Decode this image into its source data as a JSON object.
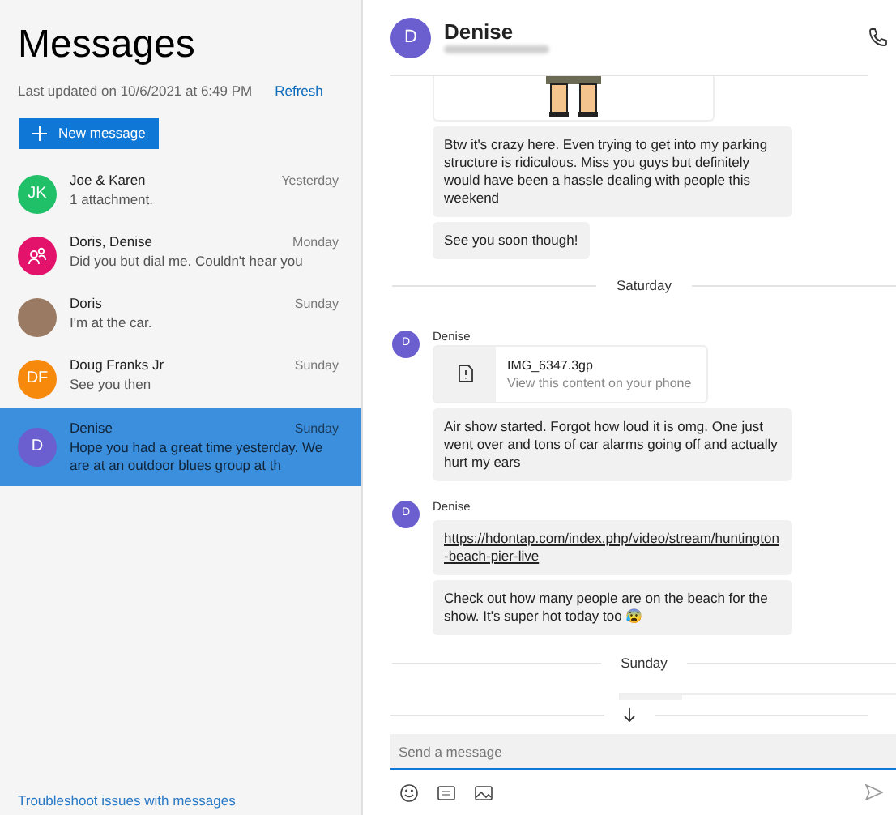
{
  "sidebar": {
    "title": "Messages",
    "last_updated": "Last updated on 10/6/2021 at 6:49 PM",
    "refresh": "Refresh",
    "new_message": "New message",
    "conversations": [
      {
        "avatar": {
          "kind": "initials",
          "initials": "JK",
          "color": "#1fc068"
        },
        "name": "Joe & Karen",
        "time": "Yesterday",
        "preview": "1 attachment.",
        "selected": false
      },
      {
        "avatar": {
          "kind": "group",
          "color": "#e3126b"
        },
        "name": "Doris, Denise",
        "time": "Monday",
        "preview": "Did you but dial me. Couldn't hear you",
        "selected": false
      },
      {
        "avatar": {
          "kind": "photo"
        },
        "name": "Doris",
        "time": "Sunday",
        "preview": "I'm at the car.",
        "selected": false
      },
      {
        "avatar": {
          "kind": "initials",
          "initials": "DF",
          "color": "#f7890c"
        },
        "name": "Doug Franks Jr",
        "time": "Sunday",
        "preview": "See you then",
        "selected": false
      },
      {
        "avatar": {
          "kind": "initials",
          "initials": "D",
          "color": "#6b5fcf"
        },
        "name": "Denise",
        "time": "Sunday",
        "preview": "Hope you had a great time yesterday. We are at an outdoor blues group at th",
        "selected": true
      }
    ],
    "troubleshoot": "Troubleshoot issues with messages"
  },
  "chat": {
    "contact": {
      "initials": "D",
      "name": "Denise"
    },
    "items": [
      {
        "kind": "sticker"
      },
      {
        "kind": "text",
        "text": "Btw it's crazy here. Even trying to get into my parking structure is ridiculous. Miss you guys but definitely would have been a hassle dealing with people this weekend"
      },
      {
        "kind": "text",
        "text": "See you soon though!"
      },
      {
        "kind": "divider",
        "text": "Saturday"
      },
      {
        "kind": "sender",
        "initials": "D",
        "name": "Denise"
      },
      {
        "kind": "attachment",
        "filename": "IMG_6347.3gp",
        "note": "View this content on your phone"
      },
      {
        "kind": "text",
        "text": "Air show started. Forgot how loud it is omg. One just went over and tons of car alarms going off and actually hurt my ears"
      },
      {
        "kind": "sender",
        "initials": "D",
        "name": "Denise"
      },
      {
        "kind": "link",
        "text": "https://hdontap.com/index.php/video/stream/huntington-beach-pier-live"
      },
      {
        "kind": "text",
        "text": "Check out how many people are on the beach for the show. It's super hot today too 😰"
      },
      {
        "kind": "divider",
        "text": "Sunday"
      },
      {
        "kind": "partial"
      }
    ],
    "composer": {
      "placeholder": "Send a message"
    }
  }
}
